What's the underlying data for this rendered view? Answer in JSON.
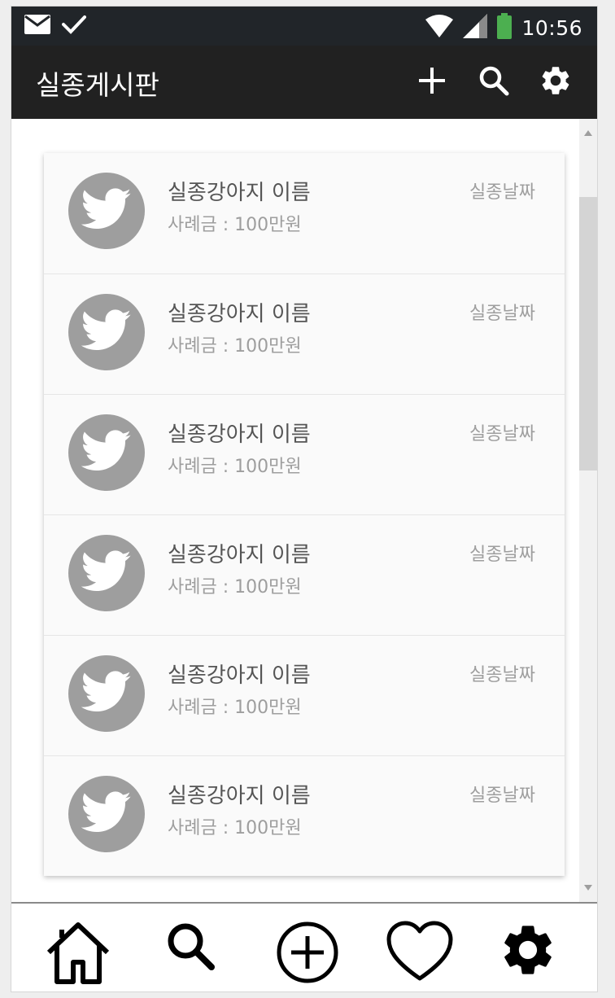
{
  "status_bar": {
    "time": "10:56",
    "left_icons": [
      "mail-icon",
      "check-icon"
    ],
    "right_icons": [
      "wifi-icon",
      "signal-icon",
      "battery-icon"
    ],
    "battery_color": "#4caf50"
  },
  "app_bar": {
    "title": "실종게시판",
    "actions": [
      "add-icon",
      "search-icon",
      "settings-icon"
    ]
  },
  "list": {
    "items": [
      {
        "name": "실종강아지 이름",
        "reward": "사례금 : 100만원",
        "date": "실종날짜",
        "icon": "twitter-bird-icon"
      },
      {
        "name": "실종강아지 이름",
        "reward": "사례금 : 100만원",
        "date": "실종날짜",
        "icon": "twitter-bird-icon"
      },
      {
        "name": "실종강아지 이름",
        "reward": "사례금 : 100만원",
        "date": "실종날짜",
        "icon": "twitter-bird-icon"
      },
      {
        "name": "실종강아지 이름",
        "reward": "사례금 : 100만원",
        "date": "실종날짜",
        "icon": "twitter-bird-icon"
      },
      {
        "name": "실종강아지 이름",
        "reward": "사례금 : 100만원",
        "date": "실종날짜",
        "icon": "twitter-bird-icon"
      },
      {
        "name": "실종강아지 이름",
        "reward": "사례금 : 100만원",
        "date": "실종날짜",
        "icon": "twitter-bird-icon"
      }
    ]
  },
  "bottom_nav": {
    "items": [
      "home-icon",
      "search-icon",
      "add-circle-icon",
      "heart-icon",
      "settings-icon"
    ]
  },
  "colors": {
    "status_bar_bg": "#212529",
    "app_bar_bg": "#212121",
    "card_bg": "#fafafa",
    "avatar_bg": "#9e9e9e"
  }
}
